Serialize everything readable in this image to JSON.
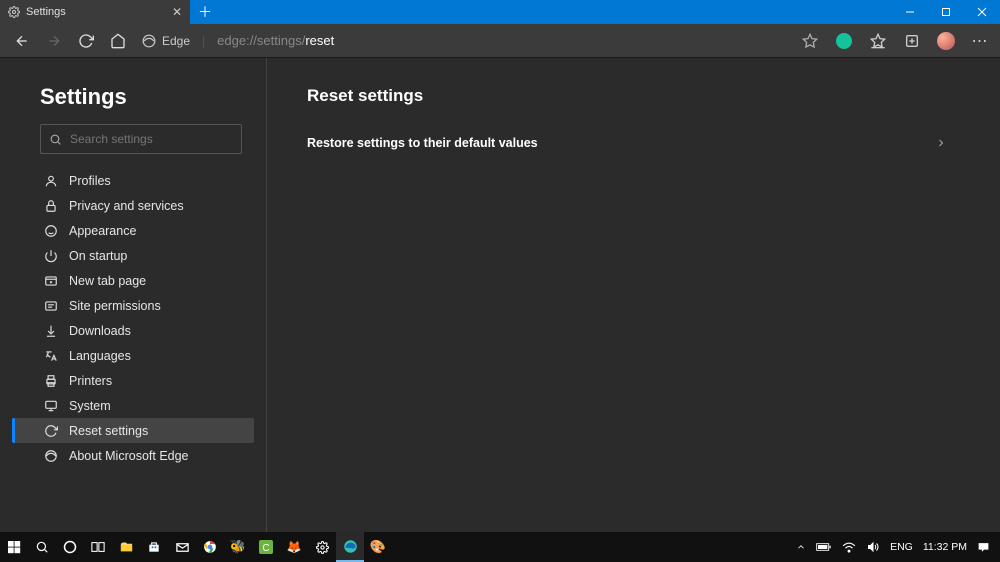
{
  "tab": {
    "title": "Settings"
  },
  "address": {
    "badge": "Edge",
    "url_prefix": "edge://settings/",
    "url_page": "reset"
  },
  "sidebar": {
    "title": "Settings",
    "search_placeholder": "Search settings",
    "items": [
      {
        "label": "Profiles",
        "icon": "person-icon"
      },
      {
        "label": "Privacy and services",
        "icon": "lock-icon"
      },
      {
        "label": "Appearance",
        "icon": "appearance-icon"
      },
      {
        "label": "On startup",
        "icon": "power-icon"
      },
      {
        "label": "New tab page",
        "icon": "newtab-icon"
      },
      {
        "label": "Site permissions",
        "icon": "permissions-icon"
      },
      {
        "label": "Downloads",
        "icon": "download-icon"
      },
      {
        "label": "Languages",
        "icon": "language-icon"
      },
      {
        "label": "Printers",
        "icon": "printer-icon"
      },
      {
        "label": "System",
        "icon": "system-icon"
      },
      {
        "label": "Reset settings",
        "icon": "reset-icon",
        "active": true
      },
      {
        "label": "About Microsoft Edge",
        "icon": "edge-icon"
      }
    ]
  },
  "main": {
    "heading": "Reset settings",
    "rows": [
      {
        "label": "Restore settings to their default values"
      }
    ]
  },
  "taskbar": {
    "lang": "ENG",
    "time": "11:32 PM"
  }
}
